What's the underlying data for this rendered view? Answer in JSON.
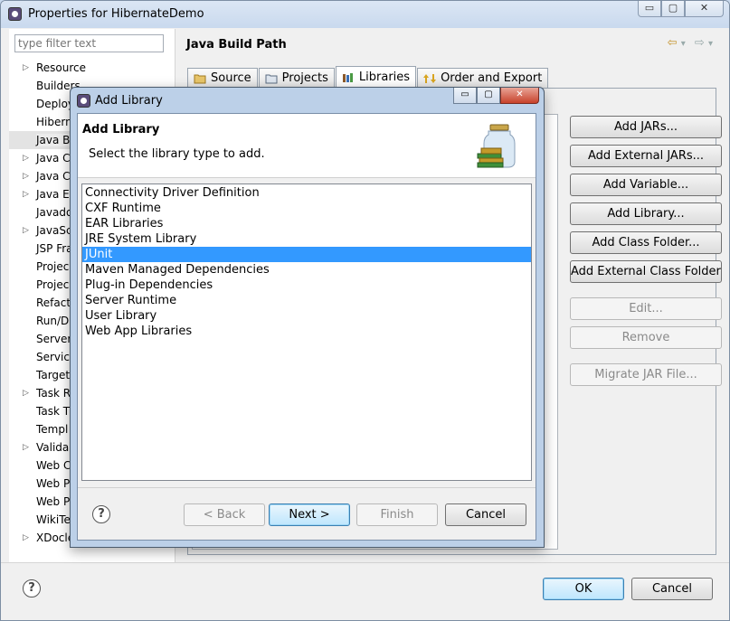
{
  "window": {
    "title": "Properties for HibernateDemo",
    "caption_buttons": {
      "minimize": "▭",
      "maximize": "▢",
      "close": "✕"
    }
  },
  "filter": {
    "placeholder": "type filter text"
  },
  "tree": [
    {
      "label": "Resource",
      "expandable": true
    },
    {
      "label": "Builders",
      "expandable": false
    },
    {
      "label": "Deploy",
      "expandable": false
    },
    {
      "label": "Hibern",
      "expandable": false
    },
    {
      "label": "Java B",
      "expandable": false,
      "selected": true
    },
    {
      "label": "Java C",
      "expandable": true
    },
    {
      "label": "Java C",
      "expandable": true
    },
    {
      "label": "Java E",
      "expandable": true
    },
    {
      "label": "Javado",
      "expandable": false
    },
    {
      "label": "JavaSc",
      "expandable": true
    },
    {
      "label": "JSP Fra",
      "expandable": false
    },
    {
      "label": "Projec",
      "expandable": false
    },
    {
      "label": "Projec",
      "expandable": false
    },
    {
      "label": "Refact",
      "expandable": false
    },
    {
      "label": "Run/D",
      "expandable": false
    },
    {
      "label": "Server",
      "expandable": false
    },
    {
      "label": "Service",
      "expandable": false
    },
    {
      "label": "Target",
      "expandable": false
    },
    {
      "label": "Task R",
      "expandable": true
    },
    {
      "label": "Task T",
      "expandable": false
    },
    {
      "label": "Templ",
      "expandable": false
    },
    {
      "label": "Valida",
      "expandable": true
    },
    {
      "label": "Web C",
      "expandable": false
    },
    {
      "label": "Web P",
      "expandable": false
    },
    {
      "label": "Web P",
      "expandable": false
    },
    {
      "label": "WikiTe",
      "expandable": false
    },
    {
      "label": "XDocle",
      "expandable": true
    }
  ],
  "main": {
    "heading": "Java Build Path",
    "nav": {
      "back": "⇦",
      "forward": "⇨",
      "dropdown": "▾"
    },
    "tabs": [
      {
        "label": "Source",
        "icon": "source-folder-icon"
      },
      {
        "label": "Projects",
        "icon": "project-icon"
      },
      {
        "label": "Libraries",
        "icon": "library-icon",
        "active": true
      },
      {
        "label": "Order and Export",
        "icon": "order-export-icon"
      }
    ],
    "buttons": [
      {
        "label": "Add JARs...",
        "enabled": true
      },
      {
        "label": "Add External JARs...",
        "enabled": true
      },
      {
        "label": "Add Variable...",
        "enabled": true
      },
      {
        "label": "Add Library...",
        "enabled": true
      },
      {
        "label": "Add Class Folder...",
        "enabled": true
      },
      {
        "label": "Add External Class Folder...",
        "enabled": true
      },
      {
        "label": "Edit...",
        "enabled": false
      },
      {
        "label": "Remove",
        "enabled": false
      },
      {
        "label": "Migrate JAR File...",
        "enabled": false
      }
    ]
  },
  "footer": {
    "help": "?",
    "ok": "OK",
    "cancel": "Cancel"
  },
  "dialog": {
    "title": "Add Library",
    "caption_buttons": {
      "minimize": "▭",
      "maximize": "▢",
      "close": "✕"
    },
    "heading": "Add Library",
    "subtitle": "Select the library type to add.",
    "libraries": [
      "Connectivity Driver Definition",
      "CXF Runtime",
      "EAR Libraries",
      "JRE System Library",
      "JUnit",
      "Maven Managed Dependencies",
      "Plug-in Dependencies",
      "Server Runtime",
      "User Library",
      "Web App Libraries"
    ],
    "selected_index": 4,
    "help": "?",
    "back": "< Back",
    "next": "Next >",
    "finish": "Finish",
    "cancel": "Cancel"
  }
}
